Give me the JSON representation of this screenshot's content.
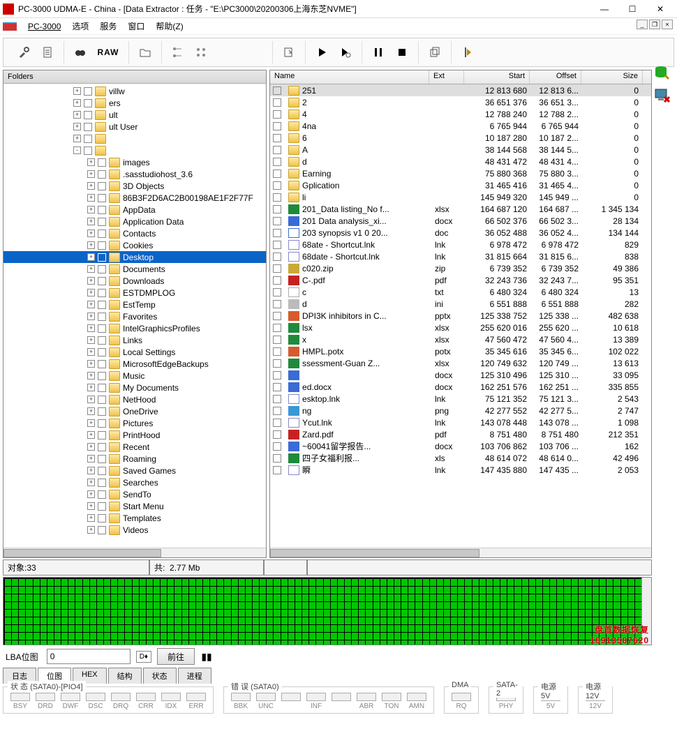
{
  "window": {
    "title": "PC-3000 UDMA-E - China - [Data Extractor : 任务 - \"E:\\PC3000\\20200306上海东芝NVME\"]"
  },
  "menu": [
    "PC-3000",
    "选项",
    "服务",
    "窗口",
    "帮助(Z)"
  ],
  "toolbar": {
    "raw": "RAW"
  },
  "folders_header": "Folders",
  "tree_upper": [
    {
      "indent": 100,
      "exp": "+",
      "label": "  villw"
    },
    {
      "indent": 100,
      "exp": "+",
      "label": "  ers"
    },
    {
      "indent": 100,
      "exp": "+",
      "label": "  ult"
    },
    {
      "indent": 100,
      "exp": "+",
      "label": "  ult User"
    },
    {
      "indent": 100,
      "exp": "+",
      "label": "  "
    },
    {
      "indent": 100,
      "exp": "-",
      "label": "  "
    }
  ],
  "tree_items": [
    "  images",
    ".sasstudiohost_3.6",
    "3D Objects",
    "86B3F2D6AC2B00198AE1F2F77F",
    "AppData",
    "Application Data",
    "Contacts",
    "Cookies"
  ],
  "tree_selected": "Desktop",
  "tree_after": [
    "Documents",
    "Downloads",
    "ESTDMPLOG",
    "EstTemp",
    "Favorites",
    "IntelGraphicsProfiles",
    "Links",
    "Local Settings",
    "MicrosoftEdgeBackups",
    "Music",
    "My Documents",
    "NetHood",
    "OneDrive",
    "Pictures",
    "PrintHood",
    "Recent",
    "Roaming",
    "Saved Games",
    "Searches",
    "SendTo",
    "Start Menu",
    "Templates",
    "Videos"
  ],
  "columns": [
    "Name",
    "Ext",
    "Start",
    "Offset",
    "Size"
  ],
  "files": [
    {
      "name": "2      5     1",
      "ext": "",
      "start": "12 813 680",
      "off": "12 813 6...",
      "size": "0",
      "t": "folder",
      "sel": true
    },
    {
      "name": "2",
      "ext": "",
      "start": "36 651 376",
      "off": "36 651 3...",
      "size": "0",
      "t": "folder"
    },
    {
      "name": "4",
      "ext": "",
      "start": "12 788 240",
      "off": "12 788 2...",
      "size": "0",
      "t": "folder"
    },
    {
      "name": "4           na",
      "ext": "",
      "start": "6 765 944",
      "off": "6 765 944",
      "size": "0",
      "t": "folder"
    },
    {
      "name": "6",
      "ext": "",
      "start": "10 187 280",
      "off": "10 187 2...",
      "size": "0",
      "t": "folder"
    },
    {
      "name": "A",
      "ext": "",
      "start": "38 144 568",
      "off": "38 144 5...",
      "size": "0",
      "t": "folder"
    },
    {
      "name": "d",
      "ext": "",
      "start": "48 431 472",
      "off": "48 431 4...",
      "size": "0",
      "t": "folder"
    },
    {
      "name": "E           arning",
      "ext": "",
      "start": "75 880 368",
      "off": "75 880 3...",
      "size": "0",
      "t": "folder"
    },
    {
      "name": "G           plication",
      "ext": "",
      "start": "31 465 416",
      "off": "31 465 4...",
      "size": "0",
      "t": "folder"
    },
    {
      "name": "li",
      "ext": "",
      "start": "145 949 320",
      "off": "145 949 ...",
      "size": "0",
      "t": "folder"
    },
    {
      "name": "20         1_Data listing_No f...",
      "ext": "xlsx",
      "start": "164 687 120",
      "off": "164 687 ...",
      "size": "1 345 134",
      "t": "xlsx"
    },
    {
      "name": "20         1 Data analysis_xi...",
      "ext": "docx",
      "start": "66 502 376",
      "off": "66 502 3...",
      "size": "28 134",
      "t": "docx"
    },
    {
      "name": "20         3 synopsis v1 0 20...",
      "ext": "doc",
      "start": "36 052 488",
      "off": "36 052 4...",
      "size": "134 144",
      "t": "doc"
    },
    {
      "name": "68         ate - Shortcut.lnk",
      "ext": "lnk",
      "start": "6 978 472",
      "off": "6 978 472",
      "size": "829",
      "t": "lnk"
    },
    {
      "name": "68         date - Shortcut.lnk",
      "ext": "lnk",
      "start": "31 815 664",
      "off": "31 815 6...",
      "size": "838",
      "t": "lnk"
    },
    {
      "name": "c          020.zip",
      "ext": "zip",
      "start": "6 739 352",
      "off": "6 739 352",
      "size": "49 386",
      "t": "zip"
    },
    {
      "name": "C          -.pdf",
      "ext": "pdf",
      "start": "32 243 736",
      "off": "32 243 7...",
      "size": "95 351",
      "t": "pdf"
    },
    {
      "name": "c",
      "ext": "txt",
      "start": "6 480 324",
      "off": "6 480 324",
      "size": "13",
      "t": "txt"
    },
    {
      "name": "d",
      "ext": "ini",
      "start": "6 551 888",
      "off": "6 551 888",
      "size": "282",
      "t": "ini"
    },
    {
      "name": "D          PI3K inhibitors in C...",
      "ext": "pptx",
      "start": "125 338 752",
      "off": "125 338 ...",
      "size": "482 638",
      "t": "pptx"
    },
    {
      "name": "           lsx",
      "ext": "xlsx",
      "start": "255 620 016",
      "off": "255 620 ...",
      "size": "10 618",
      "t": "xlsx"
    },
    {
      "name": "           x",
      "ext": "xlsx",
      "start": "47 560 472",
      "off": "47 560 4...",
      "size": "13 389",
      "t": "xlsx"
    },
    {
      "name": "           HMPL.potx",
      "ext": "potx",
      "start": "35 345 616",
      "off": "35 345 6...",
      "size": "102 022",
      "t": "potx"
    },
    {
      "name": "           ssessment-Guan Z...",
      "ext": "xlsx",
      "start": "120 749 632",
      "off": "120 749 ...",
      "size": "13 613",
      "t": "xlsx"
    },
    {
      "name": "",
      "ext": "docx",
      "start": "125 310 496",
      "off": "125 310 ...",
      "size": "33 095",
      "t": "docx"
    },
    {
      "name": "e          d.docx",
      "ext": "docx",
      "start": "162 251 576",
      "off": "162 251 ...",
      "size": "335 855",
      "t": "docx"
    },
    {
      "name": "           esktop.lnk",
      "ext": "lnk",
      "start": "75 121 352",
      "off": "75 121 3...",
      "size": "2 543",
      "t": "lnk"
    },
    {
      "name": "           ng",
      "ext": "png",
      "start": "42 277 552",
      "off": "42 277 5...",
      "size": "2 747",
      "t": "png"
    },
    {
      "name": "Y          cut.lnk",
      "ext": "lnk",
      "start": "143 078 448",
      "off": "143 078 ...",
      "size": "1 098",
      "t": "lnk"
    },
    {
      "name": "Z          ard.pdf",
      "ext": "pdf",
      "start": "8 751 480",
      "off": "8 751 480",
      "size": "212 351",
      "t": "pdf"
    },
    {
      "name": "~          60041留学报告...",
      "ext": "docx",
      "start": "103 706 862",
      "off": "103 706 ...",
      "size": "162",
      "t": "docx"
    },
    {
      "name": "四          子女福利报...",
      "ext": "xls",
      "start": "48 614 072",
      "off": "48 614 0...",
      "size": "42 496",
      "t": "xls"
    },
    {
      "name": "瞬",
      "ext": "lnk",
      "start": "147 435 880",
      "off": "147 435 ...",
      "size": "2 053",
      "t": "lnk"
    }
  ],
  "status": {
    "objects_label": "对象:",
    "objects": "33",
    "total_label": "共:",
    "total": "2.77 Mb"
  },
  "lba": {
    "label": "LBA位图",
    "value": "0",
    "goto": "前往"
  },
  "tabs": [
    "日志",
    "位图",
    "HEX",
    "结构",
    "状态",
    "进程"
  ],
  "groups": {
    "status": {
      "label": "状 态 (SATA0)-[PIO4]",
      "items": [
        "BSY",
        "DRD",
        "DWF",
        "DSC",
        "DRQ",
        "CRR",
        "IDX",
        "ERR"
      ]
    },
    "errors": {
      "label": "错 误 (SATA0)",
      "items": [
        "BBK",
        "UNC",
        "",
        "INF",
        "",
        "ABR",
        "TON",
        "AMN"
      ]
    },
    "dma": {
      "label": "DMA",
      "items": [
        "RQ"
      ]
    },
    "sata2": {
      "label": "SATA-2",
      "items": [
        "PHY"
      ]
    },
    "p5": {
      "label": "电源 5V",
      "items": [
        "5V"
      ]
    },
    "p12": {
      "label": "电源 12V",
      "items": [
        "12V"
      ]
    }
  },
  "watermark": {
    "line1": "盘首数据恢复",
    "line2": "18913587620"
  }
}
